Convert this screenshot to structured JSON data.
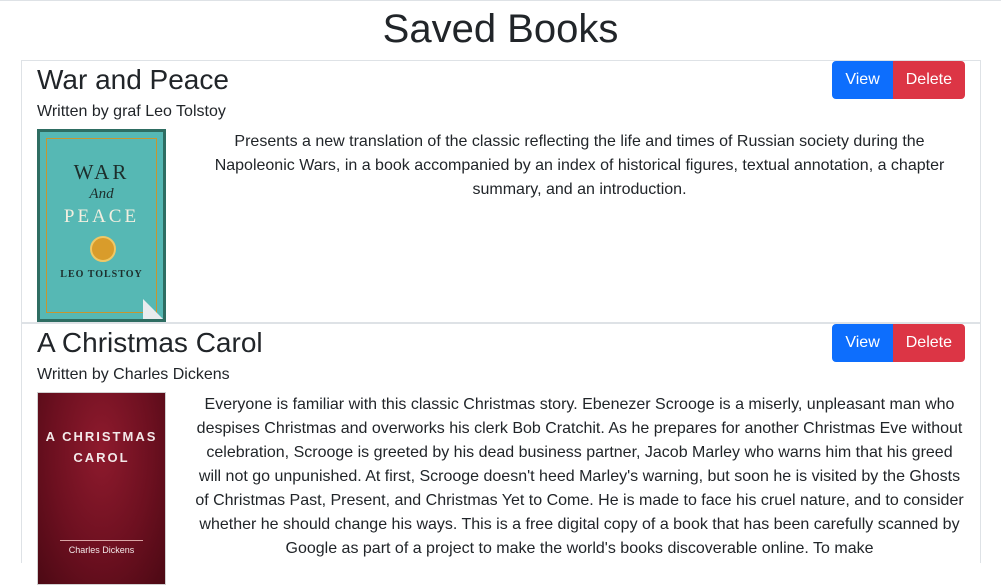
{
  "page": {
    "title": "Saved Books"
  },
  "books": [
    {
      "title": "War and Peace",
      "author_line": "Written by graf Leo Tolstoy",
      "view_label": "View",
      "delete_label": "Delete",
      "cover_text": [
        "WAR",
        "And",
        "PEACE",
        "LEO TOLSTOY"
      ],
      "description": "Presents a new translation of the classic reflecting the life and times of Russian society during the Napoleonic Wars, in a book accompanied by an index of historical figures, textual annotation, a chapter summary, and an introduction."
    },
    {
      "title": "A Christmas Carol",
      "author_line": "Written by Charles Dickens",
      "view_label": "View",
      "delete_label": "Delete",
      "cover_text": [
        "A CHRISTMAS",
        "CAROL",
        "Charles Dickens"
      ],
      "description": "Everyone is familiar with this classic Christmas story. Ebenezer Scrooge is a miserly, unpleasant man who despises Christmas and overworks his clerk Bob Cratchit. As he prepares for another Christmas Eve without celebration, Scrooge is greeted by his dead business partner, Jacob Marley who warns him that his greed will not go unpunished. At first, Scrooge doesn't heed Marley's warning, but soon he is visited by the Ghosts of Christmas Past, Present, and Christmas Yet to Come. He is made to face his cruel nature, and to consider whether he should change his ways. This is a free digital copy of a book that has been carefully scanned by Google as part of a project to make the world's books discoverable online. To make"
    }
  ],
  "colors": {
    "view_button": "#0d6efd",
    "delete_button": "#dc3545",
    "border": "#dee2e6"
  }
}
